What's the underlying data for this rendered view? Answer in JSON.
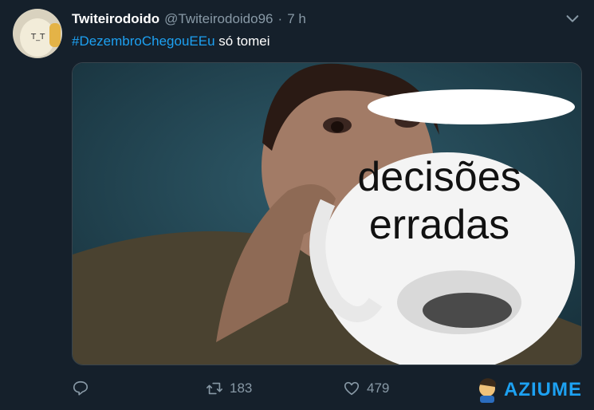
{
  "tweet": {
    "display_name": "Twiteirodoido",
    "handle": "@Twiteirodoido96",
    "separator": "·",
    "time": "7 h",
    "hashtag": "#DezembroChegouEEu",
    "text": " só tomei"
  },
  "media": {
    "caption_line1": "decisões",
    "caption_line2": "erradas"
  },
  "actions": {
    "reply_count": "",
    "retweet_count": "183",
    "like_count": "479"
  },
  "watermark": {
    "text": "AZIUME"
  },
  "colors": {
    "background": "#15202b",
    "accent": "#1da1f2",
    "muted": "#8899a6"
  }
}
